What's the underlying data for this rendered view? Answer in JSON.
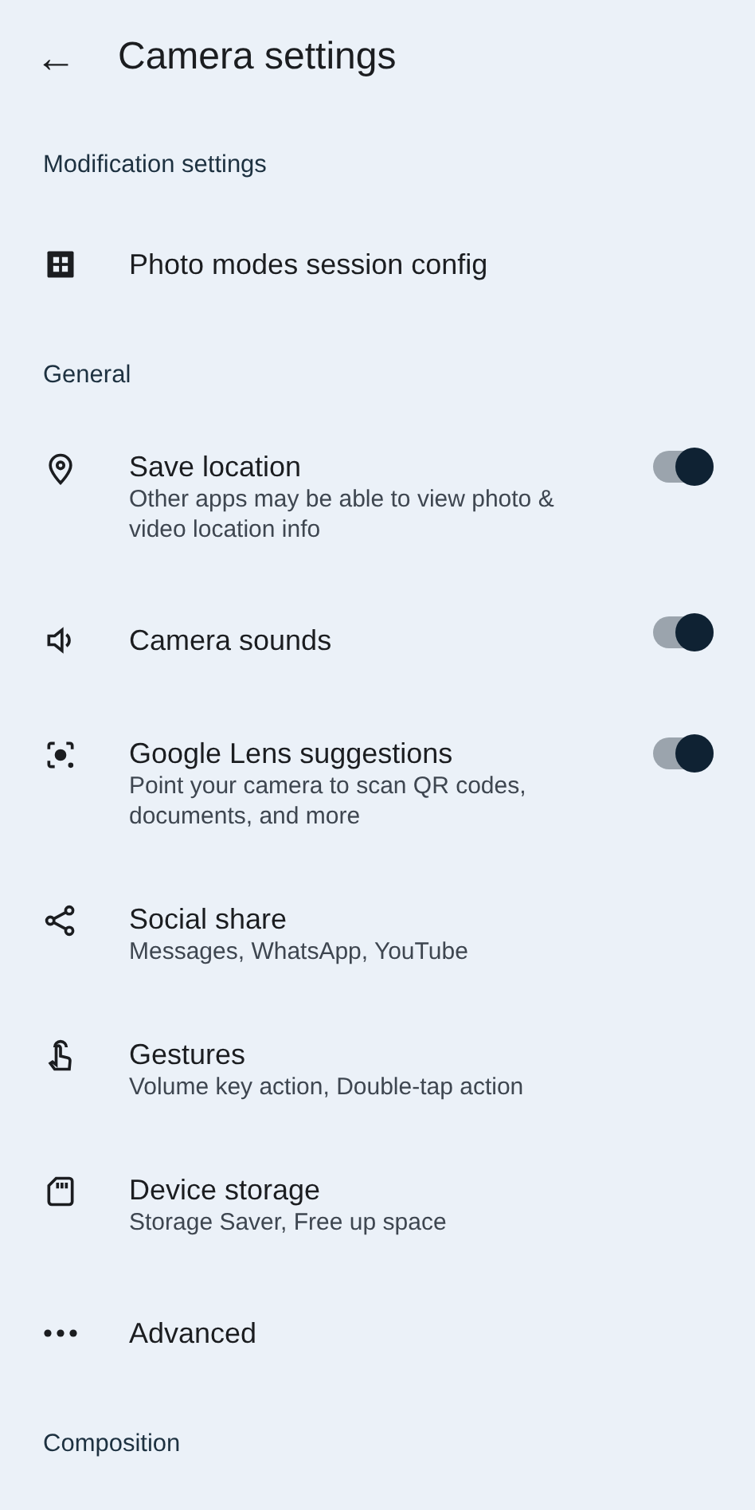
{
  "app_bar": {
    "back": "←",
    "title": "Camera settings"
  },
  "sections": [
    {
      "title": "Modification settings",
      "items": [
        {
          "kind": "link",
          "title": "Photo modes session config"
        }
      ]
    },
    {
      "title": "General",
      "items": [
        {
          "kind": "toggle",
          "title": "Save location",
          "subtitle": "Other apps may be able to view photo & video location info",
          "on": true
        },
        {
          "kind": "toggle",
          "title": "Camera sounds",
          "on": true
        },
        {
          "kind": "toggle",
          "title": "Google Lens suggestions",
          "subtitle": "Point your camera to scan QR codes, documents, and more",
          "on": true
        },
        {
          "kind": "link",
          "title": "Social share",
          "subtitle": "Messages, WhatsApp, YouTube"
        },
        {
          "kind": "link",
          "title": "Gestures",
          "subtitle": "Volume key action, Double-tap action"
        },
        {
          "kind": "link",
          "title": "Device storage",
          "subtitle": "Storage Saver, Free up space"
        },
        {
          "kind": "link",
          "title": "Advanced"
        }
      ]
    },
    {
      "title": "Composition"
    }
  ]
}
